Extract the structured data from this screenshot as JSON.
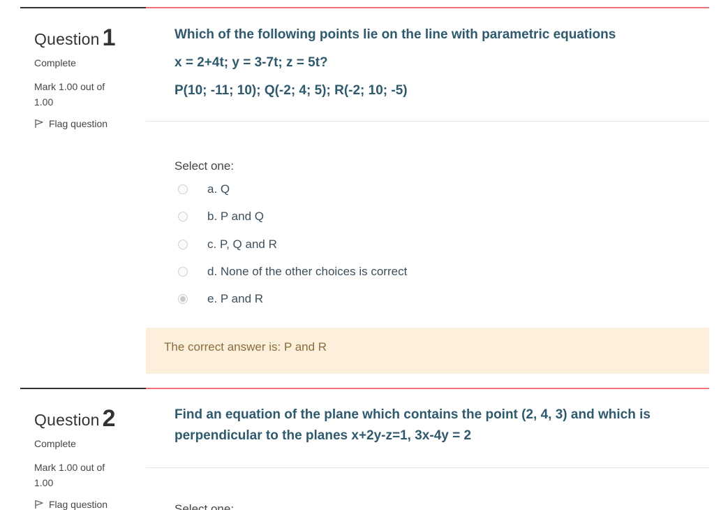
{
  "questions": [
    {
      "label": "Question",
      "number": "1",
      "state": "Complete",
      "grade": "Mark 1.00 out of 1.00",
      "flag_label": "Flag question",
      "text_lines": [
        "Which of the following points lie on the line with parametric equations",
        "x = 2+4t; y = 3-7t; z = 5t?",
        "P(10; -11; 10); Q(-2; 4; 5); R(-2; 10; -5)"
      ],
      "prompt": "Select one:",
      "options": [
        {
          "label": "a. Q",
          "checked": false
        },
        {
          "label": "b. P and Q",
          "checked": false
        },
        {
          "label": "c. P, Q and R",
          "checked": false
        },
        {
          "label": "d. None of the other choices is correct",
          "checked": false
        },
        {
          "label": "e. P and R",
          "checked": true
        }
      ],
      "feedback": "The correct answer is: P and R"
    },
    {
      "label": "Question",
      "number": "2",
      "state": "Complete",
      "grade": "Mark 1.00 out of 1.00",
      "flag_label": "Flag question",
      "text_lines": [
        "Find an equation of the plane which contains the point (2, 4, 3) and which is",
        "perpendicular to the planes x+2y-z=1, 3x-4y = 2"
      ],
      "prompt": "Select one:"
    }
  ],
  "colors": {
    "question_text": "#2f5a6e",
    "content_border": "#f16f7a",
    "feedback_bg": "#fcefdc",
    "feedback_text": "#8a6d3b"
  },
  "icons": {
    "flag": "flag-icon",
    "radio": "radio-button"
  }
}
